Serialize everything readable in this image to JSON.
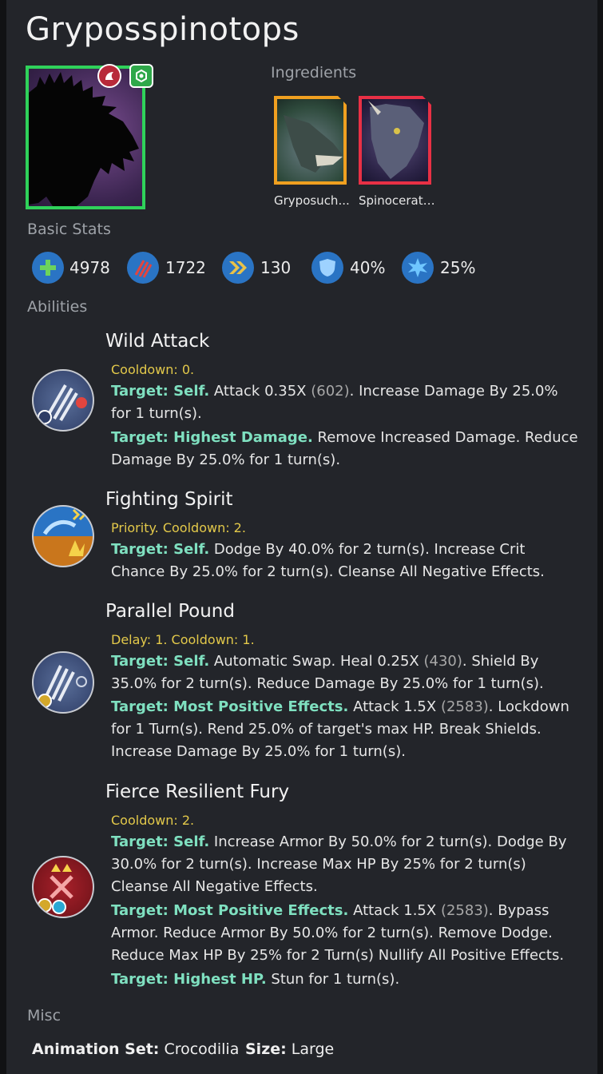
{
  "creature": {
    "name": "Gryposspinotops"
  },
  "sections": {
    "ingredients": "Ingredients",
    "basic_stats": "Basic Stats",
    "abilities": "Abilities",
    "misc": "Misc"
  },
  "ingredients": [
    {
      "label": "Gryposuch...",
      "border": "#f0a020"
    },
    {
      "label": "Spinocerato...",
      "border": "#e83045"
    }
  ],
  "stats": {
    "health": "4978",
    "damage": "1722",
    "speed": "130",
    "armor": "40%",
    "crit": "25%"
  },
  "abilities": [
    {
      "name": "Wild Attack",
      "meta": "Cooldown: 0.",
      "lines": [
        {
          "target": "Target: Self.",
          "pre": " Attack 0.35X ",
          "num": "(602)",
          "post": ". Increase Damage By 25.0% for 1 turn(s)."
        },
        {
          "target": "Target: Highest Damage.",
          "pre": " Remove Increased Damage. Reduce Damage By 25.0% for 1 turn(s).",
          "num": "",
          "post": ""
        }
      ]
    },
    {
      "name": "Fighting Spirit",
      "meta": "Priority. Cooldown: 2.",
      "lines": [
        {
          "target": "Target: Self.",
          "pre": " Dodge By 40.0% for 2 turn(s). Increase Crit Chance By 25.0% for 2 turn(s). Cleanse All Negative Effects.",
          "num": "",
          "post": ""
        }
      ]
    },
    {
      "name": "Parallel Pound",
      "meta": "Delay: 1. Cooldown: 1.",
      "lines": [
        {
          "target": "Target: Self.",
          "pre": " Automatic Swap. Heal 0.25X ",
          "num": "(430)",
          "post": ". Shield By 35.0% for 2 turn(s). Reduce Damage By 25.0% for 1 turn(s)."
        },
        {
          "target": "Target: Most Positive Effects.",
          "pre": " Attack 1.5X ",
          "num": "(2583)",
          "post": ". Lockdown for 1 Turn(s). Rend 25.0% of target's max HP. Break Shields. Increase Damage By 25.0% for 1 turn(s)."
        }
      ]
    },
    {
      "name": "Fierce Resilient Fury",
      "meta": "Cooldown: 2.",
      "lines": [
        {
          "target": "Target: Self.",
          "pre": " Increase Armor By 50.0% for 2 turn(s). Dodge By 30.0% for 2 turn(s). Increase Max HP By 25% for 2 turn(s) Cleanse All Negative Effects.",
          "num": "",
          "post": ""
        },
        {
          "target": "Target: Most Positive Effects.",
          "pre": " Attack 1.5X ",
          "num": "(2583)",
          "post": ". Bypass Armor. Reduce Armor By 50.0% for 2 turn(s). Remove Dodge. Reduce Max HP By 25% for 2 Turn(s) Nullify All Positive Effects."
        },
        {
          "target": "Target: Highest HP.",
          "pre": " Stun for 1 turn(s).",
          "num": "",
          "post": ""
        }
      ]
    }
  ],
  "misc": {
    "animation_label": "Animation Set:",
    "animation_value": " Crocodilia",
    "size_label": "Size:",
    "size_value": " Large"
  },
  "colors": {
    "portrait_border": "#2fd25a",
    "target_text": "#7fe0c0",
    "meta_text": "#e3c94a",
    "stat_icon_bg": "#2a74c4"
  },
  "icons": {
    "health": "plus-icon",
    "damage": "claw-icon",
    "speed": "chevrons-icon",
    "armor": "shield-icon",
    "crit": "burst-icon"
  }
}
